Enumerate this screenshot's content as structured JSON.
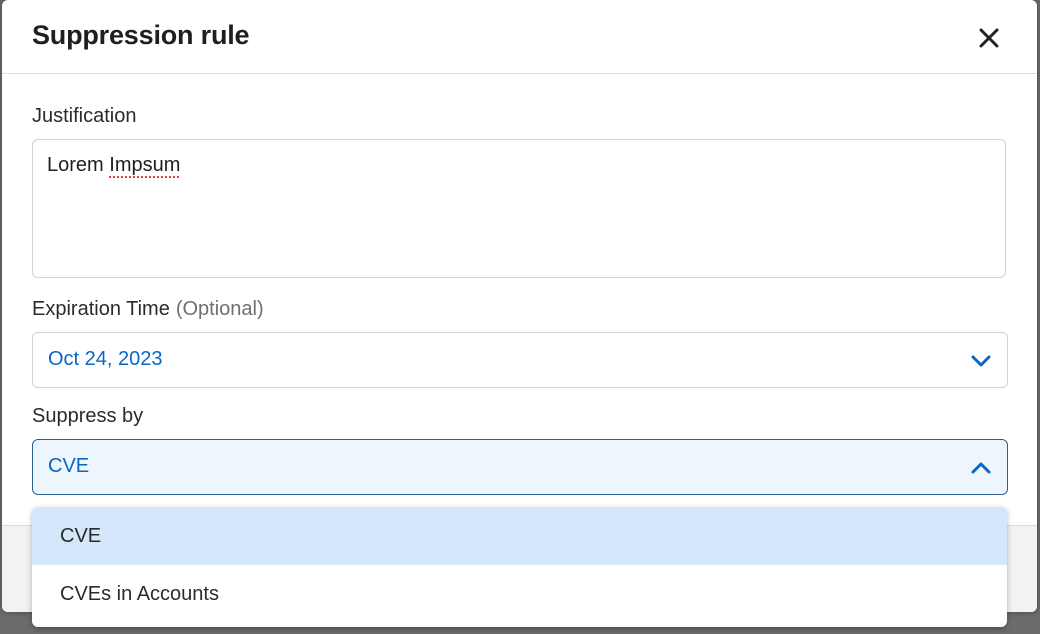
{
  "modal": {
    "title": "Suppression rule"
  },
  "justification": {
    "label": "Justification",
    "value_word1": "Lorem",
    "value_word2": "Impsum"
  },
  "expiration": {
    "label": "Expiration Time",
    "optional": "(Optional)",
    "value": "Oct 24, 2023"
  },
  "suppress_by": {
    "label": "Suppress by",
    "value": "CVE",
    "options": [
      {
        "label": "CVE",
        "selected": true
      },
      {
        "label": "CVEs in Accounts",
        "selected": false
      }
    ]
  },
  "colors": {
    "accent": "#0b66c3",
    "selected_option_bg": "#d4e7fa",
    "open_select_bg": "#eef6fd",
    "open_select_border": "#2f5f91"
  },
  "icons": {
    "close": "close-icon",
    "chevron_down": "chevron-down-icon",
    "chevron_up": "chevron-up-icon"
  }
}
